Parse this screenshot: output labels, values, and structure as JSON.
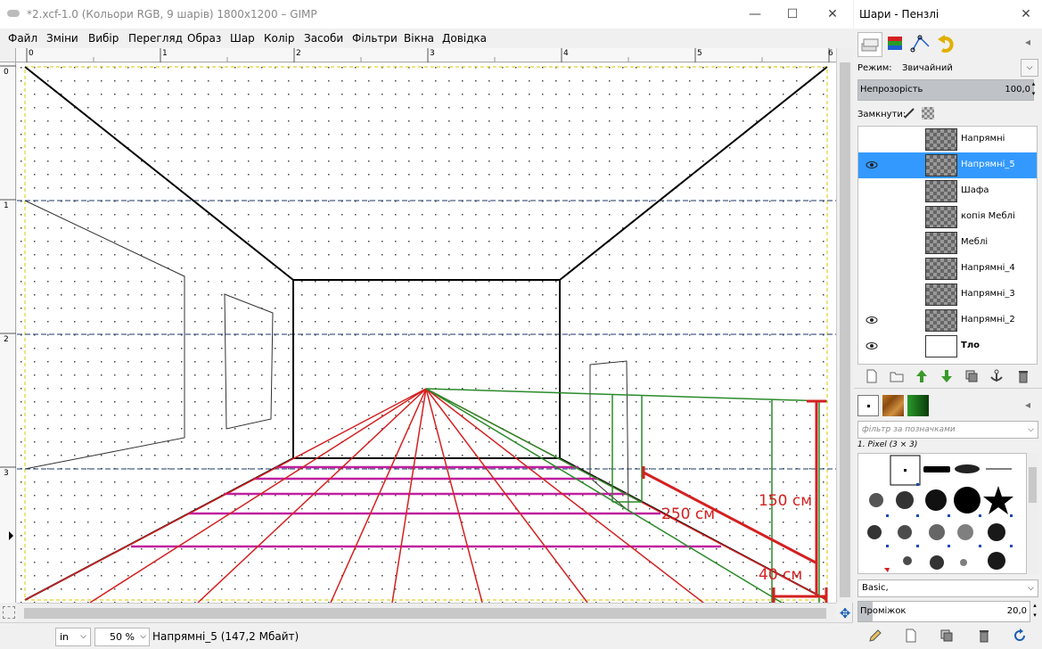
{
  "window": {
    "title": "*2.xcf-1.0 (Кольори RGB, 9 шарів) 1800x1200 – GIMP",
    "minimize": "—",
    "maximize": "☐",
    "close": "✕"
  },
  "menu": [
    "Файл",
    "Зміни",
    "Вибір",
    "Перегляд",
    "Образ",
    "Шар",
    "Колір",
    "Засоби",
    "Фільтри",
    "Вікна",
    "Довідка"
  ],
  "ruler": {
    "h_labels": [
      "0",
      "1",
      "2",
      "3",
      "4",
      "5",
      "6"
    ],
    "v_labels": [
      "0",
      "1",
      "2",
      "3"
    ]
  },
  "canvas": {
    "annotations": [
      "150 см",
      "250 см",
      "40 см"
    ]
  },
  "status": {
    "unit": "in",
    "zoom": "50 %",
    "info": "Напрямні_5 (147,2 Мбайт)"
  },
  "dock": {
    "title": "Шари - Пензлі",
    "mode_label": "Режим:",
    "mode_value": "Звичайний",
    "opacity_label": "Непрозорість",
    "opacity_value": "100,0",
    "lock_label": "Замкнути:",
    "layers": [
      {
        "name": "Напрямні",
        "visible": false,
        "selected": false,
        "bold": false
      },
      {
        "name": "Напрямні_5",
        "visible": true,
        "selected": true,
        "bold": false
      },
      {
        "name": "Шафа",
        "visible": false,
        "selected": false,
        "bold": false
      },
      {
        "name": "копія Меблі",
        "visible": false,
        "selected": false,
        "bold": false
      },
      {
        "name": "Меблі",
        "visible": false,
        "selected": false,
        "bold": false
      },
      {
        "name": "Напрямні_4",
        "visible": false,
        "selected": false,
        "bold": false
      },
      {
        "name": "Напрямні_3",
        "visible": false,
        "selected": false,
        "bold": false
      },
      {
        "name": "Напрямні_2",
        "visible": true,
        "selected": false,
        "bold": false
      },
      {
        "name": "Тло",
        "visible": true,
        "selected": false,
        "bold": true
      }
    ],
    "brush_filter_placeholder": "фільтр за позначками",
    "brush_name": "1. Pixel (3 × 3)",
    "brush_preset": "Basic,",
    "spacing_label": "Проміжок",
    "spacing_value": "20,0"
  },
  "colors": {
    "guide": "#1a3a6b",
    "green": "#2a8a2a",
    "red": "#d42020",
    "magenta": "#c020a0",
    "selection": "#3399ff"
  }
}
